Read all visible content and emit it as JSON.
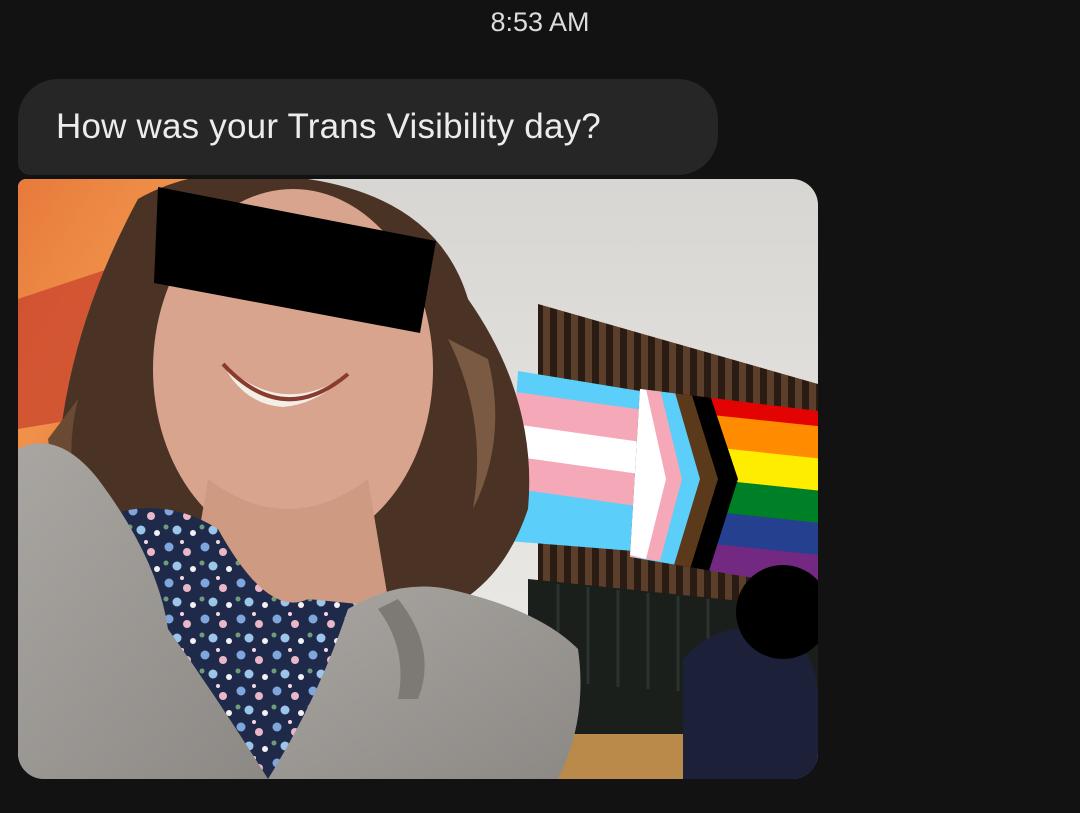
{
  "conversation": {
    "timestamp": "8:53 AM",
    "messages": [
      {
        "type": "text",
        "text": "How was your Trans Visibility day?"
      },
      {
        "type": "image",
        "colors": {
          "background": "#121212",
          "bubble": "#262626",
          "trans_blue": "#5bcefa",
          "trans_pink": "#f5a9b8",
          "trans_white": "#ffffff",
          "rainbow": [
            "#e40303",
            "#ff8c00",
            "#ffed00",
            "#008026",
            "#24408e",
            "#732982"
          ]
        }
      }
    ]
  }
}
